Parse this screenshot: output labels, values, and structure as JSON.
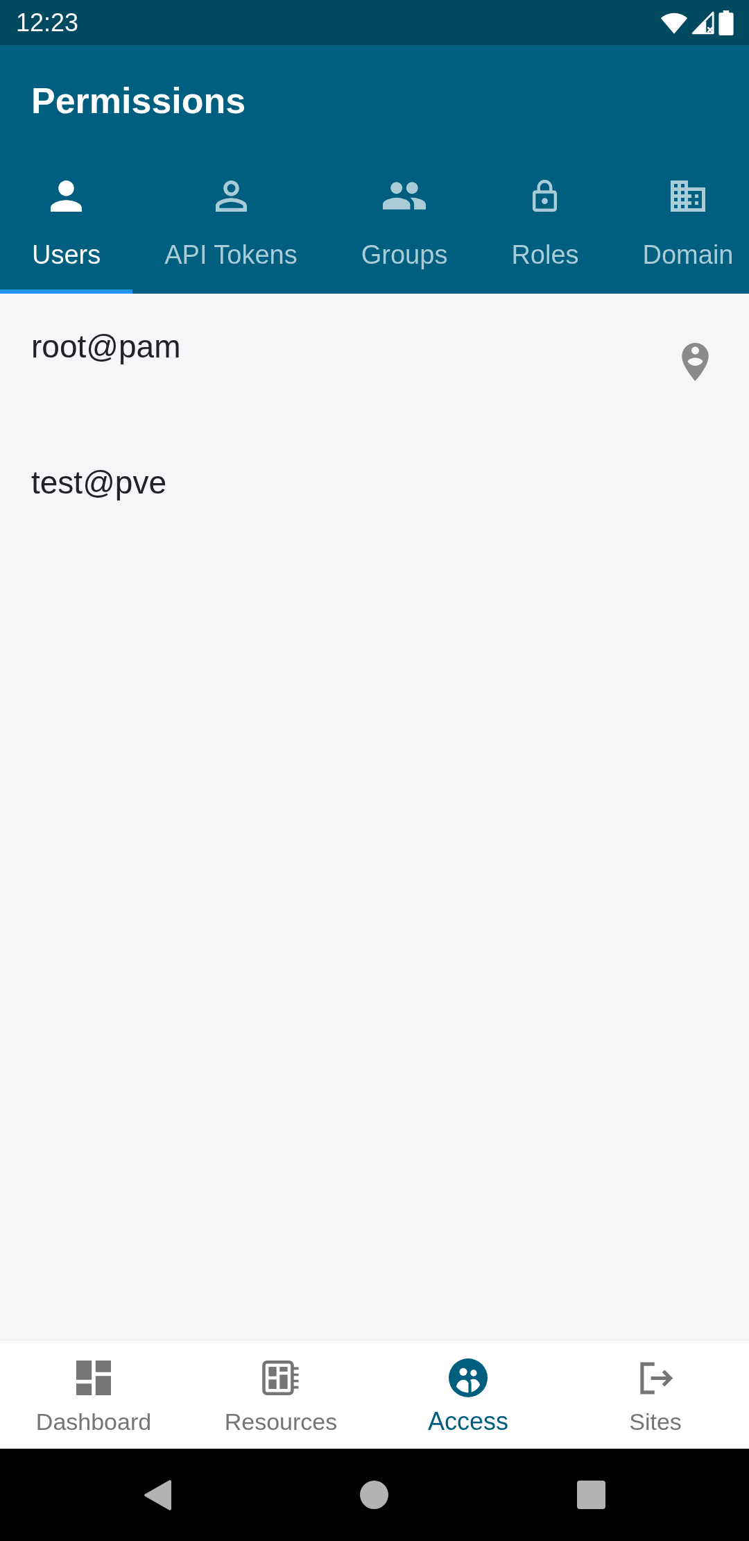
{
  "status_bar": {
    "time": "12:23"
  },
  "app_bar": {
    "title": "Permissions"
  },
  "tabs": [
    {
      "kind": "users",
      "label": "Users",
      "selected": true
    },
    {
      "kind": "tokens",
      "label": "API Tokens",
      "selected": false
    },
    {
      "kind": "groups",
      "label": "Groups",
      "selected": false
    },
    {
      "kind": "roles",
      "label": "Roles",
      "selected": false
    },
    {
      "kind": "domains",
      "label": "Domain",
      "selected": false
    }
  ],
  "users": [
    {
      "name": "root@pam",
      "marker": true
    },
    {
      "name": "test@pve",
      "marker": false
    }
  ],
  "bottom_nav": [
    {
      "kind": "dashboard",
      "label": "Dashboard",
      "selected": false
    },
    {
      "kind": "resources",
      "label": "Resources",
      "selected": false
    },
    {
      "kind": "access",
      "label": "Access",
      "selected": true
    },
    {
      "kind": "sites",
      "label": "Sites",
      "selected": false
    }
  ]
}
